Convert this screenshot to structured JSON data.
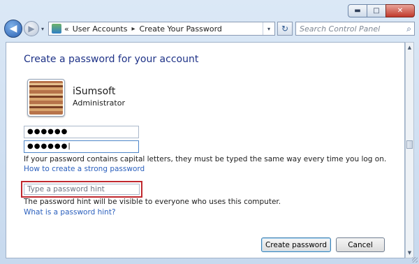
{
  "window": {
    "min_label": "▬",
    "max_label": "□",
    "close_label": "✕"
  },
  "nav": {
    "back_glyph": "◀",
    "forward_glyph": "▶",
    "history_glyph": "▾",
    "address": {
      "prefix": "«",
      "crumbs": [
        "User Accounts",
        "Create Your Password"
      ],
      "separator": "▸",
      "dropdown_glyph": "▾"
    },
    "refresh_glyph": "↻",
    "search": {
      "placeholder": "Search Control Panel",
      "icon_glyph": "⌕"
    }
  },
  "main": {
    "heading": "Create a password for your account",
    "user": {
      "name": "iSumsoft",
      "role": "Administrator"
    },
    "new_password_value": "●●●●●●",
    "confirm_password_value": "●●●●●●|",
    "caps_note": "If your password contains capital letters, they must be typed the same way every time you log on.",
    "strong_password_link": "How to create a strong password",
    "hint_placeholder": "Type a password hint",
    "hint_note": "The password hint will be visible to everyone who uses this computer.",
    "hint_link": "What is a password hint?",
    "create_button": "Create password",
    "cancel_button": "Cancel"
  },
  "colors": {
    "heading": "#1e3287",
    "link": "#2a5fbd",
    "highlight_border": "#c0282e"
  }
}
